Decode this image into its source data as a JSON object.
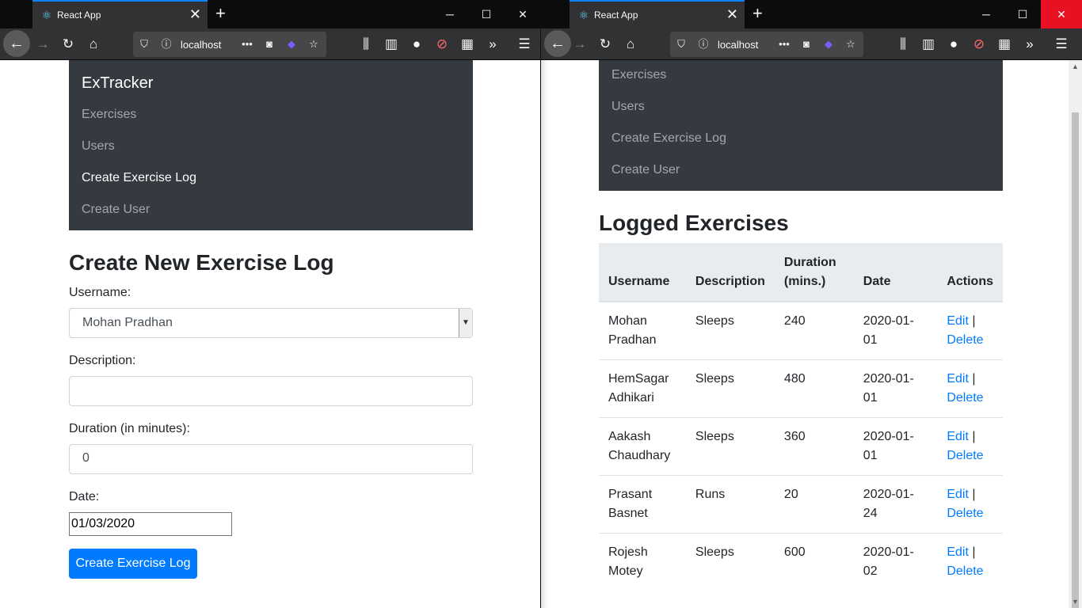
{
  "tab": {
    "title": "React App",
    "close": "✕",
    "new": "+"
  },
  "window_controls": {
    "minimize": "─",
    "maximize": "☐",
    "close": "✕"
  },
  "url": {
    "text": "localhost",
    "more": "•••"
  },
  "site": {
    "brand": "ExTracker",
    "nav": [
      "Exercises",
      "Users",
      "Create Exercise Log",
      "Create User"
    ]
  },
  "form": {
    "title": "Create New Exercise Log",
    "username_label": "Username:",
    "username_value": "Mohan Pradhan",
    "description_label": "Description:",
    "description_value": "",
    "duration_label": "Duration (in minutes):",
    "duration_value": "0",
    "date_label": "Date:",
    "date_value": "01/03/2020",
    "submit_label": "Create Exercise Log"
  },
  "list": {
    "title": "Logged Exercises",
    "headers": [
      "Username",
      "Description",
      "Duration (mins.)",
      "Date",
      "Actions"
    ],
    "rows": [
      {
        "username": "Mohan Pradhan",
        "description": "Sleeps",
        "duration": "240",
        "date": "2020-01-01"
      },
      {
        "username": "HemSagar Adhikari",
        "description": "Sleeps",
        "duration": "480",
        "date": "2020-01-01"
      },
      {
        "username": "Aakash Chaudhary",
        "description": "Sleeps",
        "duration": "360",
        "date": "2020-01-01"
      },
      {
        "username": "Prasant Basnet",
        "description": "Runs",
        "duration": "20",
        "date": "2020-01-24"
      },
      {
        "username": "Rojesh Motey",
        "description": "Sleeps",
        "duration": "600",
        "date": "2020-01-02"
      }
    ],
    "edit_label": "Edit",
    "separator": "|",
    "delete_label": "Delete"
  },
  "icons": [
    "react-icon",
    "back-icon",
    "forward-icon",
    "reload-icon",
    "home-icon",
    "shield-icon",
    "info-icon",
    "pocket-icon",
    "extension-icon",
    "star-icon",
    "library-icon",
    "sidebar-icon",
    "account-icon",
    "blocker-icon",
    "grid-icon",
    "overflow-icon",
    "menu-icon"
  ],
  "colors": {
    "navbar": "#343a40",
    "primary": "#007bff",
    "close_hover": "#e81123"
  }
}
